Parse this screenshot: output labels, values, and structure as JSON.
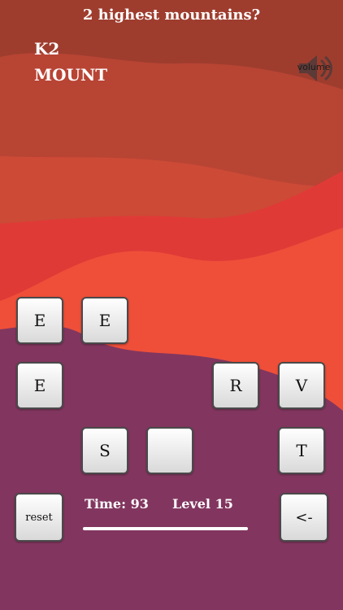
{
  "question": "2 highest mountains?",
  "answers": [
    "K2",
    "MOUNT"
  ],
  "volume_label": "volume",
  "tiles": {
    "row1": [
      "E",
      "E"
    ],
    "row2": [
      "E",
      "R",
      "V"
    ],
    "row3": [
      "S",
      "",
      "T"
    ]
  },
  "controls": {
    "reset_label": "reset",
    "back_label": "<-"
  },
  "status": {
    "time_label": "Time: 93",
    "level_label": "Level 15",
    "progress": 1.0
  },
  "colors": {
    "band1": "#9e3d2e",
    "band2": "#b84434",
    "band3": "#cc4a36",
    "band4": "#e03a37",
    "band5": "#ef4f39",
    "ground": "#82365f",
    "text": "#ffffff"
  }
}
